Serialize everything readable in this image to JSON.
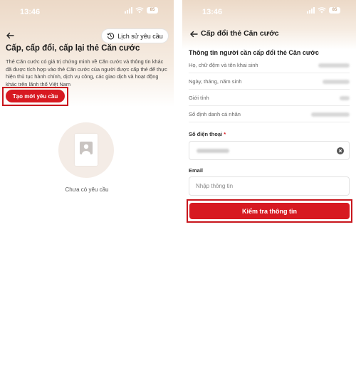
{
  "status_bar": {
    "time": "13:46",
    "battery": "85"
  },
  "left_screen": {
    "history_button": "Lịch sử yêu cầu",
    "title": "Cấp, cấp đổi, cấp lại thẻ Căn cước",
    "description": "Thẻ Căn cước có giá trị chứng minh về Căn cước và thông tin khác đã được tích hợp vào thẻ Căn cước của người được cấp thẻ để thực hiện thủ tục hành chính, dịch vụ công, các giao dịch và hoạt động khác trên lãnh thổ Việt Nam",
    "create_button": "Tạo mới yêu cầu",
    "empty_text": "Chưa có yêu cầu"
  },
  "right_screen": {
    "nav_title": "Cấp đổi thẻ Căn cước",
    "section_title": "Thông tin người cần cấp đổi thẻ Căn cước",
    "info_rows": [
      {
        "label": "Họ, chữ đệm và tên khai sinh"
      },
      {
        "label": "Ngày, tháng, năm sinh"
      },
      {
        "label": "Giới tính"
      },
      {
        "label": "Số định danh cá nhân"
      }
    ],
    "phone_label": "Số điện thoại",
    "phone_required": "*",
    "email_label": "Email",
    "email_placeholder": "Nhập thông tin",
    "submit_button": "Kiểm tra thông tin"
  },
  "colors": {
    "brand_red": "#d71921",
    "highlight_outline": "#c8161d",
    "header_gradient_top": "#ecd9c7"
  },
  "icons": [
    "back-arrow-icon",
    "history-clock-icon",
    "signal-icon",
    "wifi-icon",
    "battery-icon",
    "id-card-avatar-icon",
    "clear-icon"
  ]
}
